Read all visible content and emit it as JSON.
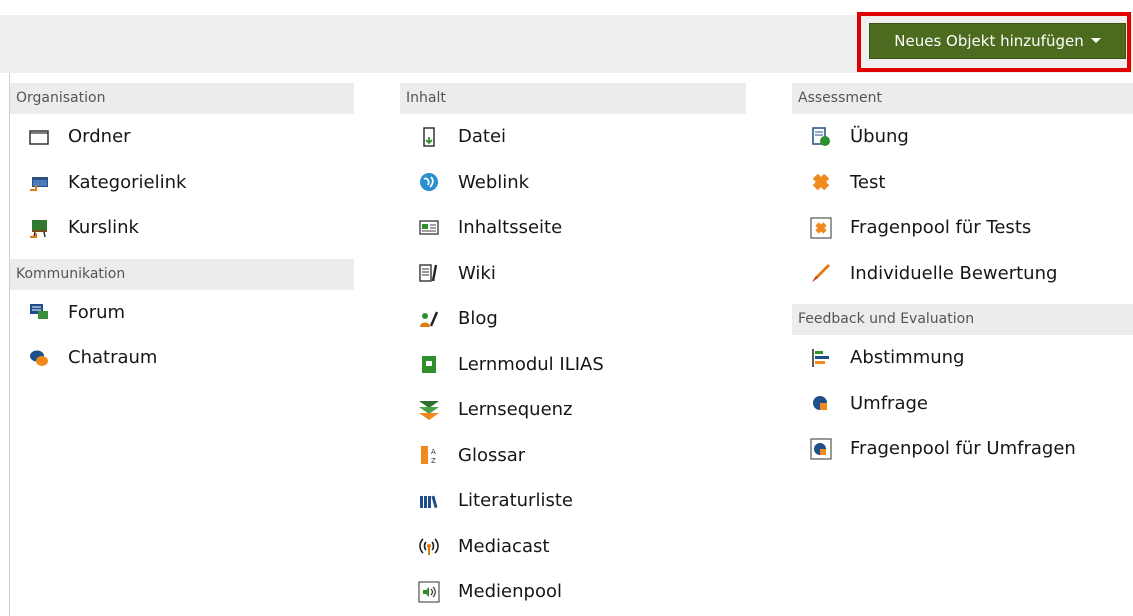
{
  "header": {
    "add_button_label": "Neues Objekt hinzufügen"
  },
  "columns": [
    {
      "sections": [
        {
          "title": "Organisation",
          "items": [
            {
              "label": "Ordner",
              "icon": "folder-icon"
            },
            {
              "label": "Kategorielink",
              "icon": "category-link-icon"
            },
            {
              "label": "Kurslink",
              "icon": "course-link-icon"
            }
          ]
        },
        {
          "title": "Kommunikation",
          "items": [
            {
              "label": "Forum",
              "icon": "forum-icon"
            },
            {
              "label": "Chatraum",
              "icon": "chat-icon"
            }
          ]
        }
      ]
    },
    {
      "sections": [
        {
          "title": "Inhalt",
          "items": [
            {
              "label": "Datei",
              "icon": "file-icon"
            },
            {
              "label": "Weblink",
              "icon": "weblink-icon"
            },
            {
              "label": "Inhaltsseite",
              "icon": "content-page-icon"
            },
            {
              "label": "Wiki",
              "icon": "wiki-icon"
            },
            {
              "label": "Blog",
              "icon": "blog-icon"
            },
            {
              "label": "Lernmodul ILIAS",
              "icon": "learning-module-icon"
            },
            {
              "label": "Lernsequenz",
              "icon": "learning-sequence-icon"
            },
            {
              "label": "Glossar",
              "icon": "glossary-icon"
            },
            {
              "label": "Literaturliste",
              "icon": "bibliography-icon"
            },
            {
              "label": "Mediacast",
              "icon": "mediacast-icon"
            },
            {
              "label": "Medienpool",
              "icon": "media-pool-icon"
            }
          ]
        }
      ]
    },
    {
      "sections": [
        {
          "title": "Assessment",
          "items": [
            {
              "label": "Übung",
              "icon": "exercise-icon"
            },
            {
              "label": "Test",
              "icon": "test-icon"
            },
            {
              "label": "Fragenpool für Tests",
              "icon": "test-question-pool-icon"
            },
            {
              "label": "Individuelle Bewertung",
              "icon": "individual-assessment-icon"
            }
          ]
        },
        {
          "title": "Feedback und Evaluation",
          "items": [
            {
              "label": "Abstimmung",
              "icon": "poll-icon"
            },
            {
              "label": "Umfrage",
              "icon": "survey-icon"
            },
            {
              "label": "Fragenpool für Umfragen",
              "icon": "survey-question-pool-icon"
            }
          ]
        }
      ]
    }
  ]
}
